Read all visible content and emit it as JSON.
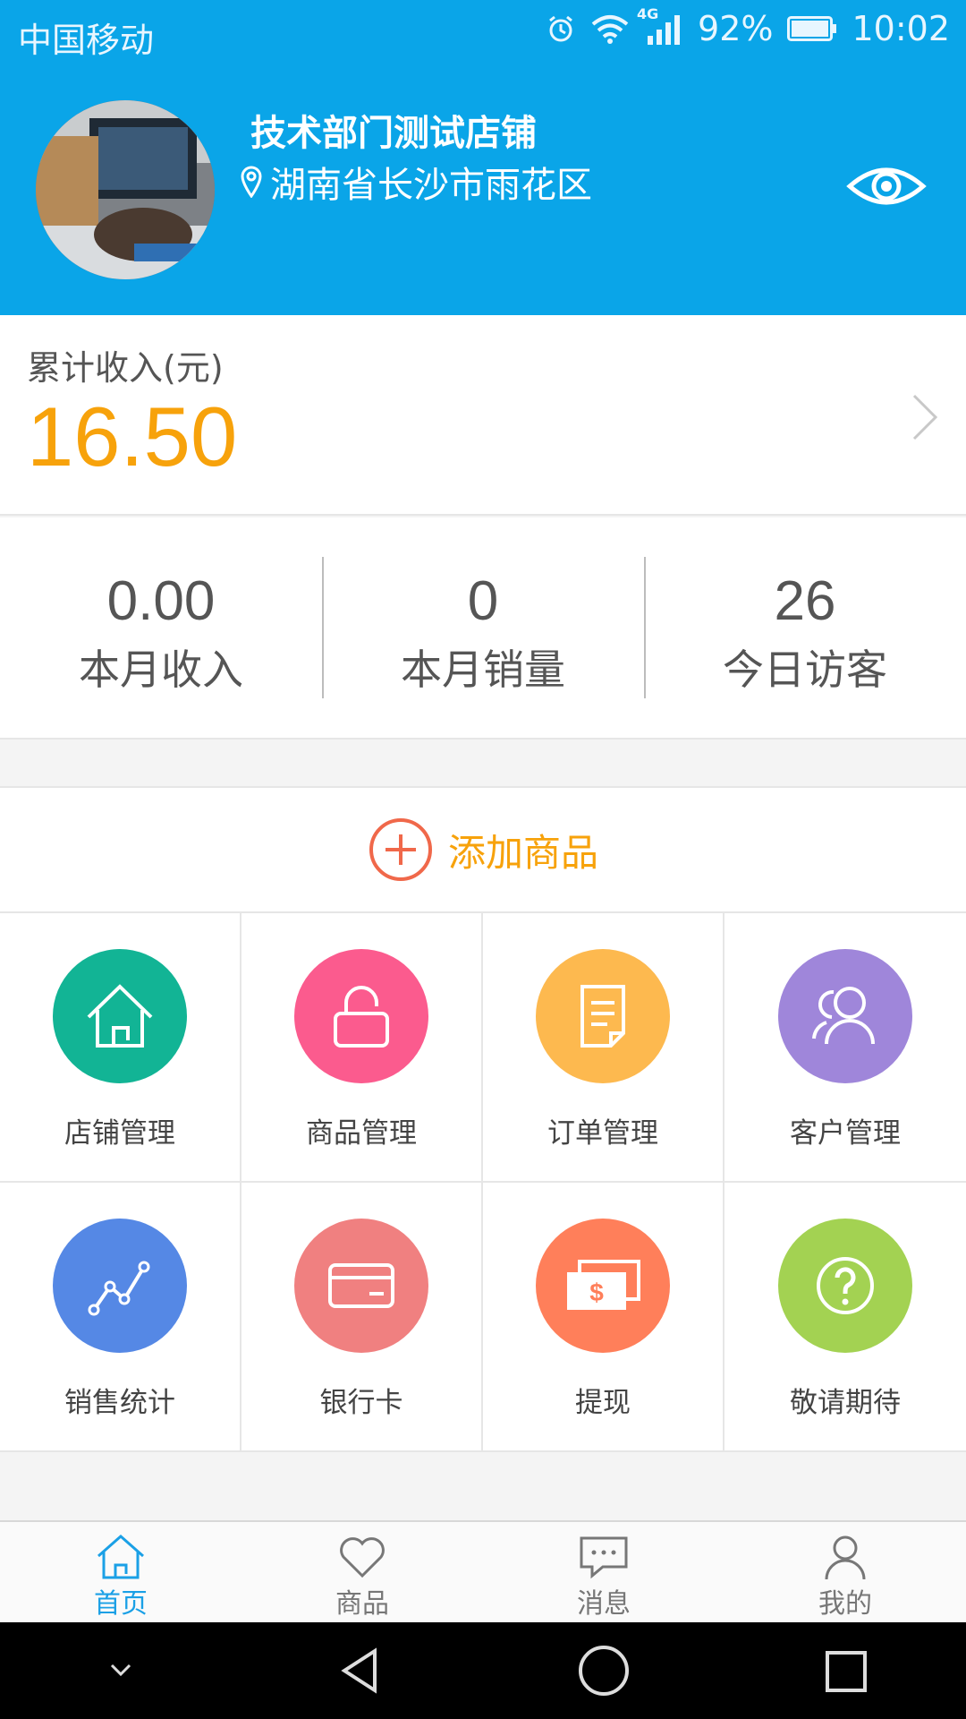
{
  "status_bar": {
    "carrier": "中国移动",
    "network": "4G",
    "battery": "92%",
    "time": "10:02"
  },
  "header": {
    "shop_name": "技术部门测试店铺",
    "location": "湖南省长沙市雨花区",
    "icons": {
      "location": "location-pin-icon",
      "visibility": "eye-icon"
    }
  },
  "income": {
    "label": "累计收入(元)",
    "value": "16.50"
  },
  "stats": [
    {
      "value": "0.00",
      "label": "本月收入"
    },
    {
      "value": "0",
      "label": "本月销量"
    },
    {
      "value": "26",
      "label": "今日访客"
    }
  ],
  "add_product": {
    "label": "添加商品",
    "icon": "plus-circle-icon"
  },
  "grid": [
    {
      "label": "店铺管理",
      "icon": "house-icon",
      "color": "#12b495"
    },
    {
      "label": "商品管理",
      "icon": "lock-icon",
      "color": "#fb5b8e"
    },
    {
      "label": "订单管理",
      "icon": "document-icon",
      "color": "#fdb94f"
    },
    {
      "label": "客户管理",
      "icon": "users-icon",
      "color": "#9f86da"
    },
    {
      "label": "销售统计",
      "icon": "line-chart-icon",
      "color": "#5588e5"
    },
    {
      "label": "银行卡",
      "icon": "card-icon",
      "color": "#f08080"
    },
    {
      "label": "提现",
      "icon": "cash-icon",
      "color": "#ff7f5a"
    },
    {
      "label": "敬请期待",
      "icon": "question-icon",
      "color": "#a3d252"
    }
  ],
  "tabs": [
    {
      "label": "首页",
      "icon": "home-icon",
      "active": true
    },
    {
      "label": "商品",
      "icon": "heart-icon",
      "active": false
    },
    {
      "label": "消息",
      "icon": "message-icon",
      "active": false
    },
    {
      "label": "我的",
      "icon": "user-icon",
      "active": false
    }
  ],
  "colors": {
    "primary": "#0aa5e8",
    "accent": "#f7a20b",
    "tab_active": "#1aa0e6"
  }
}
